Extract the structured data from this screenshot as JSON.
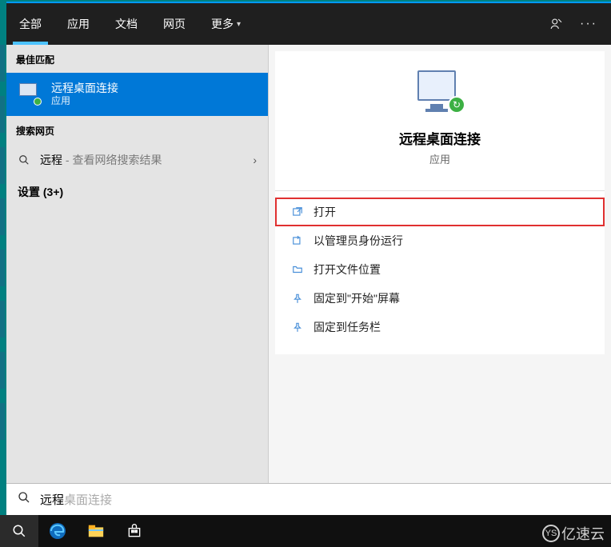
{
  "tabs": {
    "all": "全部",
    "app": "应用",
    "doc": "文档",
    "web": "网页",
    "more": "更多"
  },
  "left": {
    "best_match_header": "最佳匹配",
    "best_match": {
      "title": "远程桌面连接",
      "subtitle": "应用"
    },
    "search_web_header": "搜索网页",
    "web_row": {
      "term": "远程",
      "suffix": " - 查看网络搜索结果"
    },
    "settings": "设置 (3+)"
  },
  "right": {
    "title": "远程桌面连接",
    "subtitle": "应用",
    "actions": {
      "open": "打开",
      "run_admin": "以管理员身份运行",
      "open_loc": "打开文件位置",
      "pin_start": "固定到\"开始\"屏幕",
      "pin_taskbar": "固定到任务栏"
    }
  },
  "search": {
    "typed": "远程",
    "ghost": "桌面连接"
  },
  "watermark": "亿速云"
}
